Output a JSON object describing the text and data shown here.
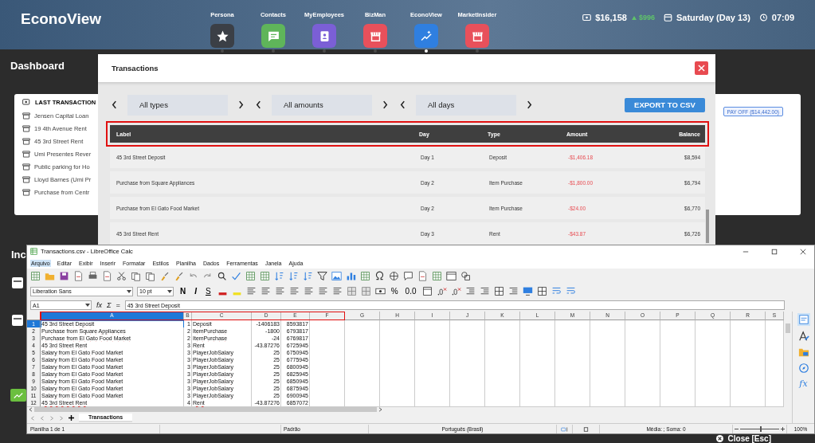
{
  "top_bar": {
    "title": "EconoView",
    "apps": [
      {
        "label": "Persona",
        "kind": "star",
        "color": "#3b3f46",
        "selected": false
      },
      {
        "label": "Contacts",
        "kind": "chat",
        "color": "#5fb55a",
        "selected": false
      },
      {
        "label": "MyEmployees",
        "kind": "badge",
        "color": "#7b5fd6",
        "selected": false
      },
      {
        "label": "BizMan",
        "kind": "store",
        "color": "#e8505b",
        "selected": false
      },
      {
        "label": "EconoView",
        "kind": "chart",
        "color": "#2f7fe0",
        "selected": true
      },
      {
        "label": "MarketInsider",
        "kind": "store",
        "color": "#e8505b",
        "selected": false
      }
    ],
    "money": "$16,158",
    "money_change": "$996",
    "date": "Saturday (Day 13)",
    "time": "07:09"
  },
  "dashboard": {
    "title": "Dashboard",
    "last_transactions": {
      "title": "LAST TRANSACTION",
      "items": [
        "Jensen Capital Loan",
        "19 4th Avenue Rent",
        "45 3rd Street Rent",
        "Umi Presentes Rever",
        "Public parking for Ho",
        "Lloyd Barnes (Umi Pr",
        "Purchase from Centr"
      ]
    },
    "pay_off_button": "PAY OFF ($14,442.00)",
    "income_title": "Inc"
  },
  "transactions_modal": {
    "title": "Transactions",
    "filters": [
      "All types",
      "All amounts",
      "All days"
    ],
    "export_button": "EXPORT TO CSV",
    "columns": [
      "Label",
      "Day",
      "Type",
      "Amount",
      "Balance"
    ],
    "rows": [
      {
        "label": "45 3rd Street Deposit",
        "day": "Day 1",
        "type": "Deposit",
        "amount": "-$1,406.18",
        "balance": "$8,594"
      },
      {
        "label": "Purchase from Square Appliances",
        "day": "Day 2",
        "type": "Item Purchase",
        "amount": "-$1,800.00",
        "balance": "$6,794"
      },
      {
        "label": "Purchase from El Gato Food Market",
        "day": "Day 2",
        "type": "Item Purchase",
        "amount": "-$24.00",
        "balance": "$6,770"
      },
      {
        "label": "45 3rd Street Rent",
        "day": "Day 3",
        "type": "Rent",
        "amount": "-$43.87",
        "balance": "$6,726"
      }
    ]
  },
  "calc": {
    "title": "Transactions.csv - LibreOffice Calc",
    "menu": [
      {
        "label": "Arquivo",
        "selected": true
      },
      {
        "label": "Editar",
        "selected": false
      },
      {
        "label": "Exibir",
        "selected": false
      },
      {
        "label": "Inserir",
        "selected": false
      },
      {
        "label": "Formatar",
        "selected": false
      },
      {
        "label": "Estilos",
        "selected": false
      },
      {
        "label": "Planilha",
        "selected": false
      },
      {
        "label": "Dados",
        "selected": false
      },
      {
        "label": "Ferramentas",
        "selected": false
      },
      {
        "label": "Janela",
        "selected": false
      },
      {
        "label": "Ajuda",
        "selected": false
      }
    ],
    "font_name": "Liberation Sans",
    "font_size": "10 pt",
    "format_buttons": [
      "N",
      "I",
      "S"
    ],
    "number_buttons": [
      "%",
      "0.0"
    ],
    "name_box": "A1",
    "formula_symbols": [
      "fx",
      "Σ",
      "="
    ],
    "formula": "45 3rd Street Deposit",
    "columns": [
      {
        "label": "A",
        "selected": true
      },
      {
        "label": "B",
        "selected": false
      },
      {
        "label": "C",
        "selected": false
      },
      {
        "label": "D",
        "selected": false
      },
      {
        "label": "E",
        "selected": false
      },
      {
        "label": "F",
        "selected": false
      },
      {
        "label": "G",
        "selected": false
      },
      {
        "label": "H",
        "selected": false
      },
      {
        "label": "I",
        "selected": false
      },
      {
        "label": "J",
        "selected": false
      },
      {
        "label": "K",
        "selected": false
      },
      {
        "label": "L",
        "selected": false
      },
      {
        "label": "M",
        "selected": false
      },
      {
        "label": "N",
        "selected": false
      },
      {
        "label": "O",
        "selected": false
      },
      {
        "label": "P",
        "selected": false
      },
      {
        "label": "Q",
        "selected": false
      },
      {
        "label": "R",
        "selected": false
      },
      {
        "label": "S",
        "selected": false
      }
    ],
    "rows": [
      {
        "number": "1",
        "cells": [
          "45 3rd Street Deposit",
          "1",
          "Deposit",
          "-1406183",
          "8593817"
        ]
      },
      {
        "number": "2",
        "cells": [
          "Purchase from Square Appliances",
          "2",
          "ItemPurchase",
          "-1800",
          "6793817"
        ]
      },
      {
        "number": "3",
        "cells": [
          "Purchase from El Gato Food Market",
          "2",
          "ItemPurchase",
          "-24",
          "6769817"
        ]
      },
      {
        "number": "4",
        "cells": [
          "45 3rd Street Rent",
          "3",
          "Rent",
          "-43.87276",
          "6725945"
        ]
      },
      {
        "number": "5",
        "cells": [
          "Salary from El Gato Food Market",
          "3",
          "PlayerJobSalary",
          "25",
          "6750945"
        ]
      },
      {
        "number": "6",
        "cells": [
          "Salary from El Gato Food Market",
          "3",
          "PlayerJobSalary",
          "25",
          "6775945"
        ]
      },
      {
        "number": "7",
        "cells": [
          "Salary from El Gato Food Market",
          "3",
          "PlayerJobSalary",
          "25",
          "6800945"
        ]
      },
      {
        "number": "8",
        "cells": [
          "Salary from El Gato Food Market",
          "3",
          "PlayerJobSalary",
          "25",
          "6825945"
        ]
      },
      {
        "number": "9",
        "cells": [
          "Salary from El Gato Food Market",
          "3",
          "PlayerJobSalary",
          "25",
          "6850945"
        ]
      },
      {
        "number": "10",
        "cells": [
          "Salary from El Gato Food Market",
          "3",
          "PlayerJobSalary",
          "25",
          "6875945"
        ]
      },
      {
        "number": "11",
        "cells": [
          "Salary from El Gato Food Market",
          "3",
          "PlayerJobSalary",
          "25",
          "6900945"
        ]
      },
      {
        "number": "12",
        "cells": [
          "45 3rd Street Rent",
          "4",
          "Rent",
          "-43.87276",
          "6857072"
        ]
      }
    ],
    "sheet_tabs": [
      {
        "label": "Transactions",
        "selected": true
      }
    ],
    "sidebar_function_label": "fx",
    "status_bar": {
      "sheet": "Planilha 1 de 1",
      "style": "Padrão",
      "language": "Português (Brasil)",
      "summary": "Média: ; Soma: 0",
      "zoom": {
        "level": 0.5
      },
      "zoom_percent": "100%"
    }
  },
  "footer": {
    "close_button": "Close [Esc]"
  }
}
